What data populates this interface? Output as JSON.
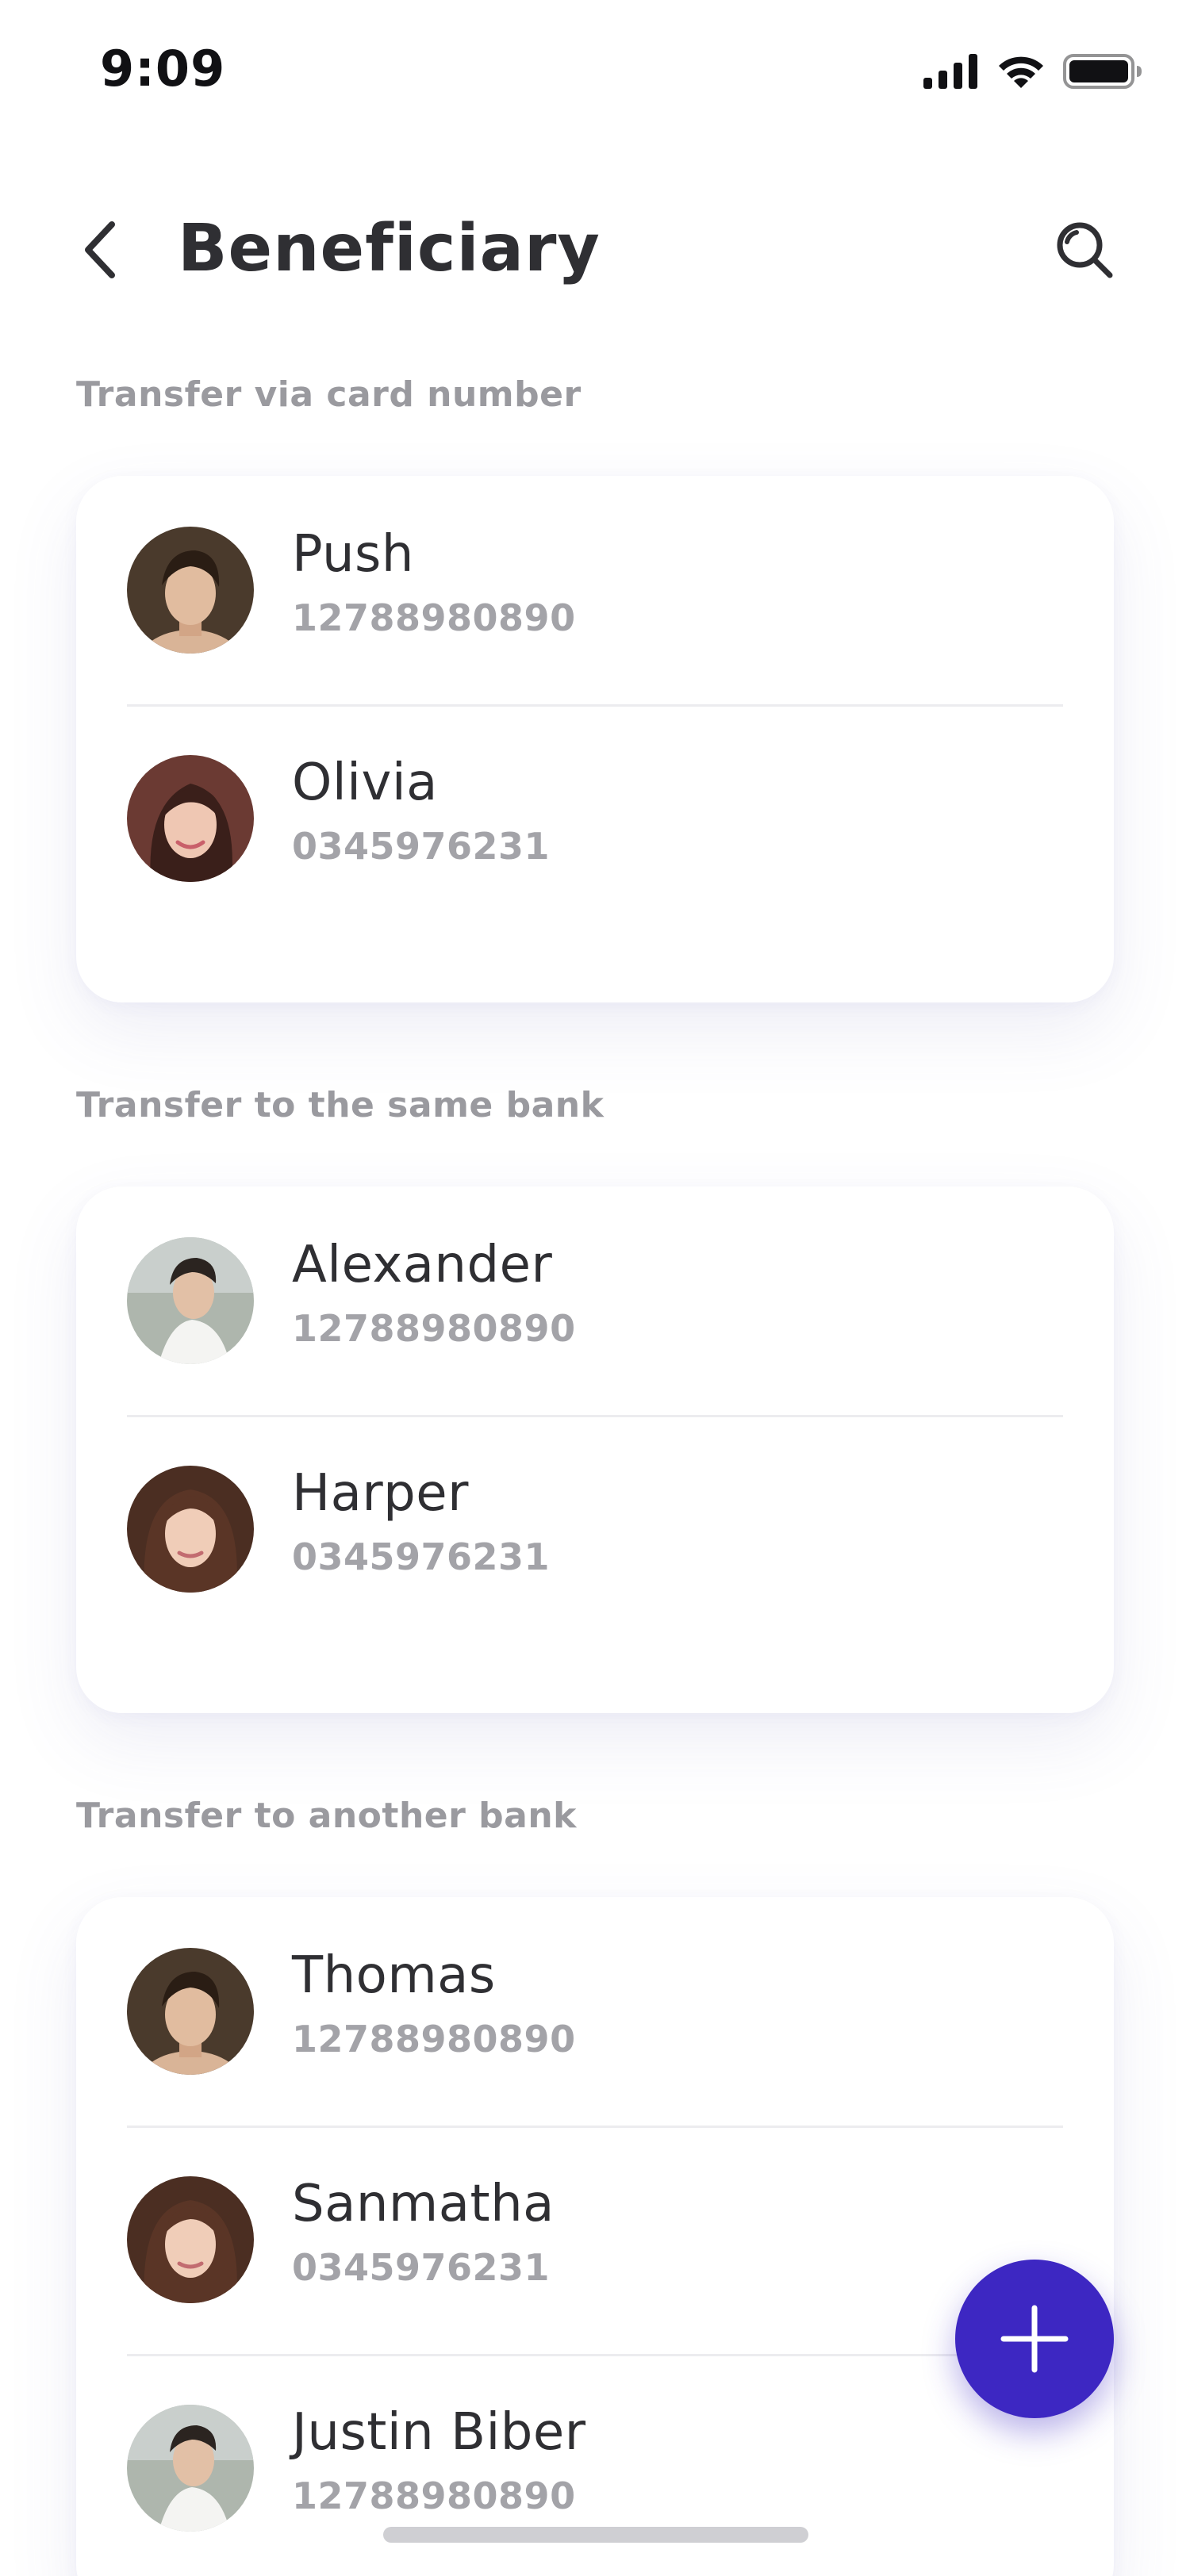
{
  "status_bar": {
    "time": "9:09",
    "icons": [
      "cellular-signal-icon",
      "wifi-icon",
      "battery-icon"
    ]
  },
  "header": {
    "title": "Beneficiary",
    "back_icon": "chevron-left-icon",
    "search_icon": "search-icon"
  },
  "sections": [
    {
      "label": "Transfer via card number",
      "items": [
        {
          "name": "Push",
          "number": "12788980890",
          "avatar": "avatar-man-dark-hair"
        },
        {
          "name": "Olivia",
          "number": "0345976231",
          "avatar": "avatar-woman-smiling"
        }
      ]
    },
    {
      "label": "Transfer to the same bank",
      "items": [
        {
          "name": "Alexander",
          "number": "12788980890",
          "avatar": "avatar-man-white-shirt"
        },
        {
          "name": "Harper",
          "number": "0345976231",
          "avatar": "avatar-woman-long-hair"
        }
      ]
    },
    {
      "label": "Transfer to another bank",
      "items": [
        {
          "name": "Thomas",
          "number": "12788980890",
          "avatar": "avatar-man-dark-hair"
        },
        {
          "name": "Sanmatha",
          "number": "0345976231",
          "avatar": "avatar-woman-long-hair"
        },
        {
          "name": "Justin Biber",
          "number": "12788980890",
          "avatar": "avatar-man-white-shirt"
        }
      ]
    }
  ],
  "fab": {
    "icon": "plus-icon"
  },
  "colors": {
    "accent": "#3d27c2",
    "title_text": "#2f2f33",
    "muted_text": "#9a9a9f",
    "divider": "#ececef"
  }
}
